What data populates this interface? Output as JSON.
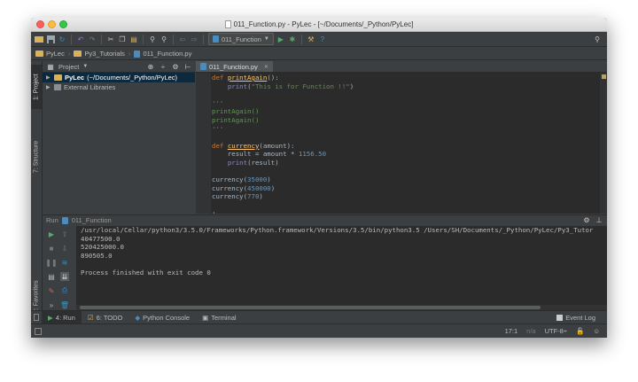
{
  "window": {
    "title": "011_Function.py - PyLec - [~/Documents/_Python/PyLec]"
  },
  "toolbar": {
    "run_config": "011_Function"
  },
  "navbar": {
    "crumbs": [
      "PyLec",
      "Py3_Tutorials",
      "011_Function.py"
    ]
  },
  "left_strip": {
    "project_tab": "1: Project",
    "structure_tab": "7: Structure",
    "favorites_tab": "2: Favorites"
  },
  "project_panel": {
    "header": "Project",
    "root_label": "PyLec",
    "root_path": "(~/Documents/_Python/PyLec)",
    "external_label": "External Libraries"
  },
  "editor": {
    "tab_label": "011_Function.py",
    "lines": [
      {
        "indent": "",
        "kw": "def",
        "fn": "printAgain",
        "rest": "():"
      },
      {
        "indent": "    ",
        "bi": "print",
        "open": "(",
        "str": "\"This is for Function !!\"",
        "close": ")"
      },
      {
        "text": ""
      },
      {
        "cm": "'''"
      },
      {
        "cm": "printAgain()"
      },
      {
        "cm": "printAgain()"
      },
      {
        "cm": "'''"
      },
      {
        "text": ""
      },
      {
        "indent": "",
        "kw": "def",
        "fn": "currency",
        "rest": "(amount):"
      },
      {
        "indent": "    ",
        "id": "result = amount * ",
        "num": "1156.50"
      },
      {
        "indent": "    ",
        "bi": "print",
        "open": "(",
        "id": "result",
        "close": ")"
      },
      {
        "text": ""
      },
      {
        "call": "currency(",
        "num": "35000",
        "close": ")"
      },
      {
        "call": "currency(",
        "num": "450000",
        "close": ")"
      },
      {
        "call": "currency(",
        "num": "770",
        "close": ")"
      },
      {
        "text": ""
      },
      {
        "text": "'"
      }
    ]
  },
  "run_panel": {
    "header_label": "Run",
    "header_config": "011_Function",
    "console_lines": [
      "/usr/local/Cellar/python3/3.5.0/Frameworks/Python.framework/Versions/3.5/bin/python3.5 /Users/SH/Documents/_Python/PyLec/Py3_Tutor",
      "40477500.0",
      "520425000.0",
      "890505.0",
      "",
      "Process finished with exit code 0"
    ]
  },
  "bottom_tabs": {
    "run": "4: Run",
    "todo": "6: TODO",
    "python_console": "Python Console",
    "terminal": "Terminal",
    "event_log": "Event Log"
  },
  "status_bar": {
    "position": "17:1",
    "na": "n/a",
    "encoding": "UTF-8÷"
  },
  "colors": {
    "keyword": "#cc7832",
    "function": "#ffc66d",
    "string": "#6a8759",
    "number": "#6897bb",
    "builtin": "#8888c6",
    "comment": "#629755",
    "run_green": "#59a869"
  }
}
